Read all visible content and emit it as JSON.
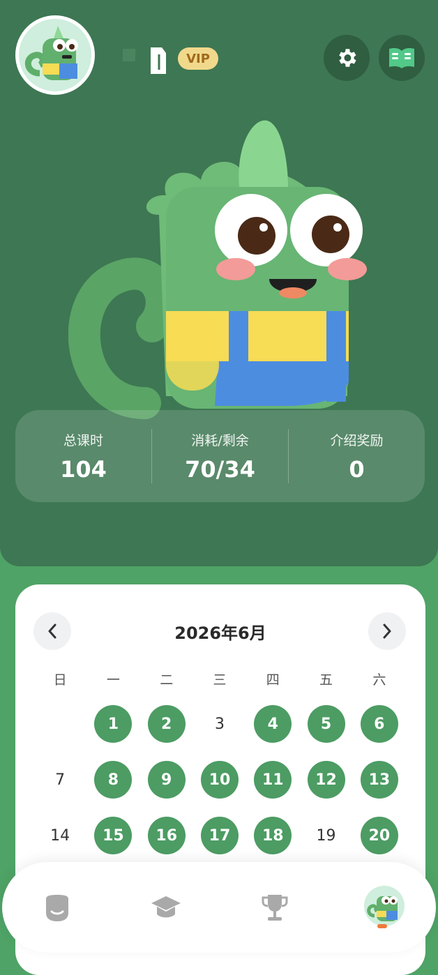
{
  "header": {
    "vip_label": "VIP"
  },
  "stats": [
    {
      "label": "总课时",
      "value": "104"
    },
    {
      "label": "消耗/剩余",
      "value": "70/34"
    },
    {
      "label": "介绍奖励",
      "value": "0"
    }
  ],
  "calendar": {
    "month_title": "2026年6月",
    "weekdays": [
      "日",
      "一",
      "二",
      "三",
      "四",
      "五",
      "六"
    ],
    "weeks": [
      [
        {
          "day": ""
        },
        {
          "day": "1",
          "attended": true
        },
        {
          "day": "2",
          "attended": true
        },
        {
          "day": "3",
          "attended": false
        },
        {
          "day": "4",
          "attended": true
        },
        {
          "day": "5",
          "attended": true
        },
        {
          "day": "6",
          "attended": true
        }
      ],
      [
        {
          "day": "7",
          "attended": false
        },
        {
          "day": "8",
          "attended": true
        },
        {
          "day": "9",
          "attended": true
        },
        {
          "day": "10",
          "attended": true
        },
        {
          "day": "11",
          "attended": true
        },
        {
          "day": "12",
          "attended": true
        },
        {
          "day": "13",
          "attended": true
        }
      ],
      [
        {
          "day": "14",
          "attended": false
        },
        {
          "day": "15",
          "attended": true
        },
        {
          "day": "16",
          "attended": true
        },
        {
          "day": "17",
          "attended": true
        },
        {
          "day": "18",
          "attended": true
        },
        {
          "day": "19",
          "attended": false
        },
        {
          "day": "20",
          "attended": true
        }
      ]
    ]
  },
  "tabs": [
    {
      "icon": "face-icon",
      "active": false
    },
    {
      "icon": "graduation-cap-icon",
      "active": false
    },
    {
      "icon": "trophy-icon",
      "active": false
    },
    {
      "icon": "mascot-avatar-icon",
      "active": true
    }
  ],
  "colors": {
    "header_bg": "#3e7753",
    "page_bg": "#4fa366",
    "attended_day": "#4c9c63",
    "vip_bg": "#f1d98c",
    "active_indicator": "#f07a3a"
  }
}
